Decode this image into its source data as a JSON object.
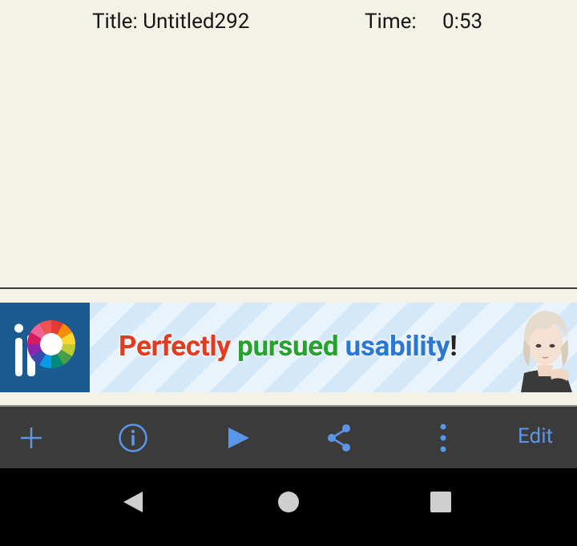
{
  "info": {
    "title": "Title: Untitled292",
    "time_label": "Time:",
    "time_value": "0:53"
  },
  "ad": {
    "logo_icon": "ibispaint-logo-icon",
    "words": [
      "Perfectly",
      "pursued",
      "usability",
      "!"
    ],
    "colors": {
      "word1": "#e33b22",
      "word2": "#27a12f",
      "word3": "#2a78d4"
    },
    "character_image": "anime-character-image"
  },
  "toolbar": {
    "items": [
      {
        "icon": "plus-icon"
      },
      {
        "icon": "info-icon"
      },
      {
        "icon": "play-icon"
      },
      {
        "icon": "share-icon"
      },
      {
        "icon": "more-vertical-icon"
      }
    ],
    "edit_label": "Edit",
    "accent": "#5a97e8"
  },
  "navbar": {
    "items": [
      {
        "icon": "back-icon"
      },
      {
        "icon": "home-icon"
      },
      {
        "icon": "recents-icon"
      }
    ]
  }
}
